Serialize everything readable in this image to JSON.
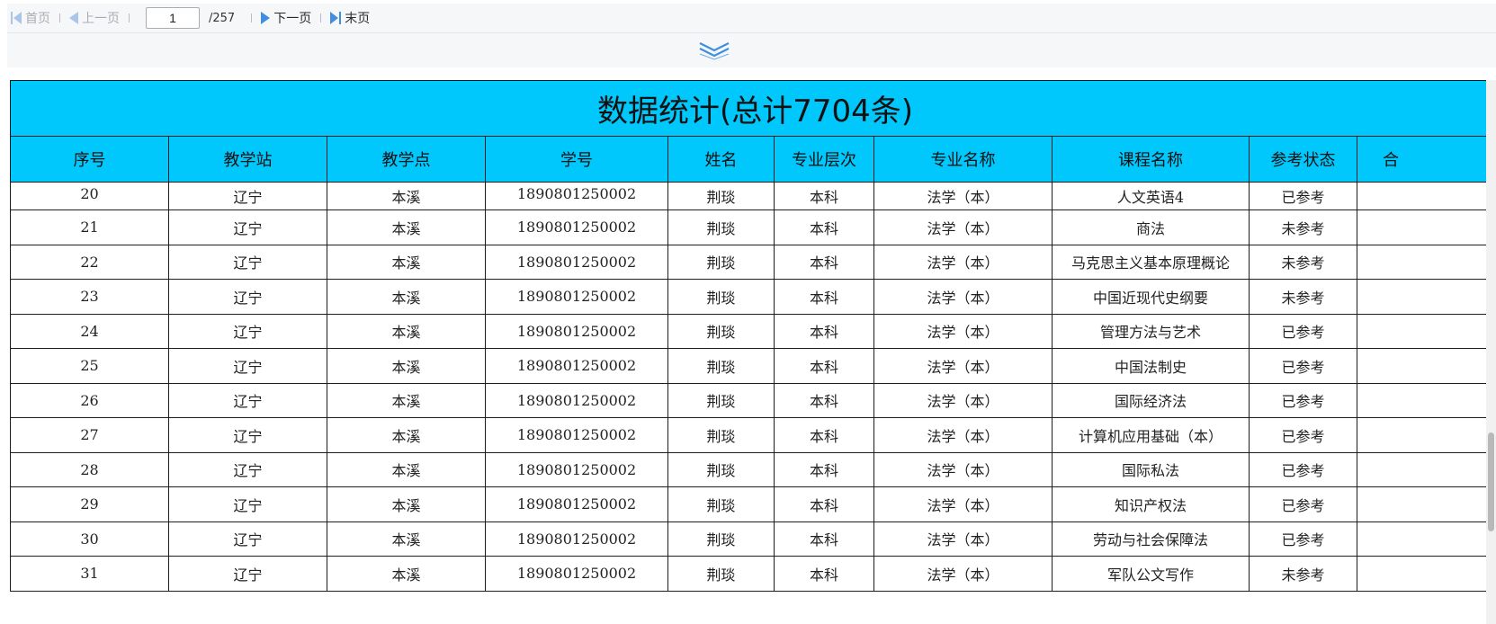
{
  "pager": {
    "first_label": "首页",
    "prev_label": "上一页",
    "current_page": "1",
    "total_pages": "/257",
    "next_label": "下一页",
    "last_label": "末页"
  },
  "colors": {
    "header_bg": "#00c7fc",
    "pager_icon_active": "#3f8ee0",
    "pager_icon_disabled": "#a9c6e8",
    "collapse_icon": "#3f8ee0"
  },
  "table": {
    "title": "数据统计(总计7704条)",
    "columns": [
      "序号",
      "教学站",
      "教学点",
      "学号",
      "姓名",
      "专业层次",
      "专业名称",
      "课程名称",
      "参考状态",
      "合"
    ],
    "rows": [
      [
        "20",
        "辽宁",
        "本溪",
        "1890801250002",
        "荆琰",
        "本科",
        "法学（本）",
        "人文英语4",
        "已参考",
        ""
      ],
      [
        "21",
        "辽宁",
        "本溪",
        "1890801250002",
        "荆琰",
        "本科",
        "法学（本）",
        "商法",
        "未参考",
        ""
      ],
      [
        "22",
        "辽宁",
        "本溪",
        "1890801250002",
        "荆琰",
        "本科",
        "法学（本）",
        "马克思主义基本原理概论",
        "未参考",
        ""
      ],
      [
        "23",
        "辽宁",
        "本溪",
        "1890801250002",
        "荆琰",
        "本科",
        "法学（本）",
        "中国近现代史纲要",
        "未参考",
        ""
      ],
      [
        "24",
        "辽宁",
        "本溪",
        "1890801250002",
        "荆琰",
        "本科",
        "法学（本）",
        "管理方法与艺术",
        "已参考",
        ""
      ],
      [
        "25",
        "辽宁",
        "本溪",
        "1890801250002",
        "荆琰",
        "本科",
        "法学（本）",
        "中国法制史",
        "已参考",
        ""
      ],
      [
        "26",
        "辽宁",
        "本溪",
        "1890801250002",
        "荆琰",
        "本科",
        "法学（本）",
        "国际经济法",
        "已参考",
        ""
      ],
      [
        "27",
        "辽宁",
        "本溪",
        "1890801250002",
        "荆琰",
        "本科",
        "法学（本）",
        "计算机应用基础（本）",
        "已参考",
        ""
      ],
      [
        "28",
        "辽宁",
        "本溪",
        "1890801250002",
        "荆琰",
        "本科",
        "法学（本）",
        "国际私法",
        "已参考",
        ""
      ],
      [
        "29",
        "辽宁",
        "本溪",
        "1890801250002",
        "荆琰",
        "本科",
        "法学（本）",
        "知识产权法",
        "已参考",
        ""
      ],
      [
        "30",
        "辽宁",
        "本溪",
        "1890801250002",
        "荆琰",
        "本科",
        "法学（本）",
        "劳动与社会保障法",
        "已参考",
        ""
      ],
      [
        "31",
        "辽宁",
        "本溪",
        "1890801250002",
        "荆琰",
        "本科",
        "法学（本）",
        "军队公文写作",
        "未参考",
        ""
      ]
    ]
  }
}
